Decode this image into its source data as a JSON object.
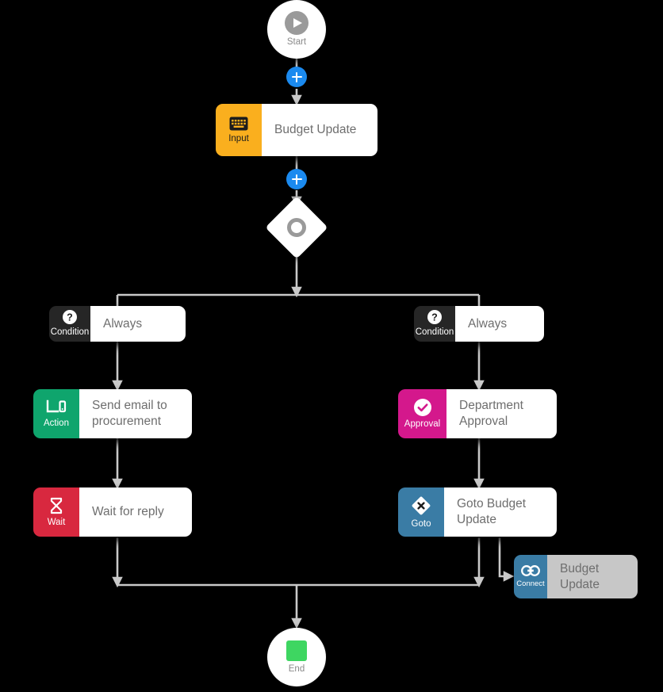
{
  "diagram": {
    "title": "Workflow builder canvas",
    "background_color": "#000000",
    "edge_color": "#c9c9c9"
  },
  "nodes": {
    "start": {
      "label": "Start",
      "icon": "play-icon",
      "shape": "circle",
      "fill": "#ffffff",
      "icon_color": "#9a9a9a"
    },
    "input": {
      "chip_label": "Input",
      "text": "Budget Update",
      "icon": "keyboard-icon",
      "chip_color": "#faaf1e",
      "body_color": "#ffffff"
    },
    "decision": {
      "label": "",
      "icon": "ring-icon",
      "shape": "diamond",
      "fill": "#ffffff",
      "icon_color": "#9a9a9a"
    },
    "condition_left": {
      "chip_label": "Condition",
      "text": "Always",
      "icon": "question-circle-icon",
      "chip_color": "#262626",
      "body_color": "#ffffff"
    },
    "condition_right": {
      "chip_label": "Condition",
      "text": "Always",
      "icon": "question-circle-icon",
      "chip_color": "#262626",
      "body_color": "#ffffff"
    },
    "action": {
      "chip_label": "Action",
      "text": "Send email to procurement",
      "icon": "monitor-icon",
      "chip_color": "#0fa56d",
      "body_color": "#ffffff"
    },
    "wait": {
      "chip_label": "Wait",
      "text": "Wait for reply",
      "icon": "hourglass-icon",
      "chip_color": "#d8283f",
      "body_color": "#ffffff"
    },
    "approval": {
      "chip_label": "Approval",
      "text": "Department Approval",
      "icon": "check-circle-icon",
      "chip_color": "#d4188c",
      "body_color": "#ffffff"
    },
    "goto": {
      "chip_label": "Goto",
      "text": "Goto Budget Update",
      "icon": "x-diamond-icon",
      "chip_color": "#3a7ca5",
      "body_color": "#ffffff"
    },
    "connect": {
      "chip_label": "Connect",
      "text": "Budget Update",
      "icon": "link-icon",
      "chip_color": "#3a7ca5",
      "body_color": "#c7c7c7"
    },
    "end": {
      "label": "End",
      "icon": "stop-square-icon",
      "shape": "circle",
      "fill": "#ffffff",
      "icon_color": "#3ed661"
    }
  },
  "add_buttons": [
    {
      "name": "add-step-after-start",
      "icon": "plus-icon",
      "color": "#1b8aef"
    },
    {
      "name": "add-step-after-input",
      "icon": "plus-icon",
      "color": "#1b8aef"
    }
  ]
}
